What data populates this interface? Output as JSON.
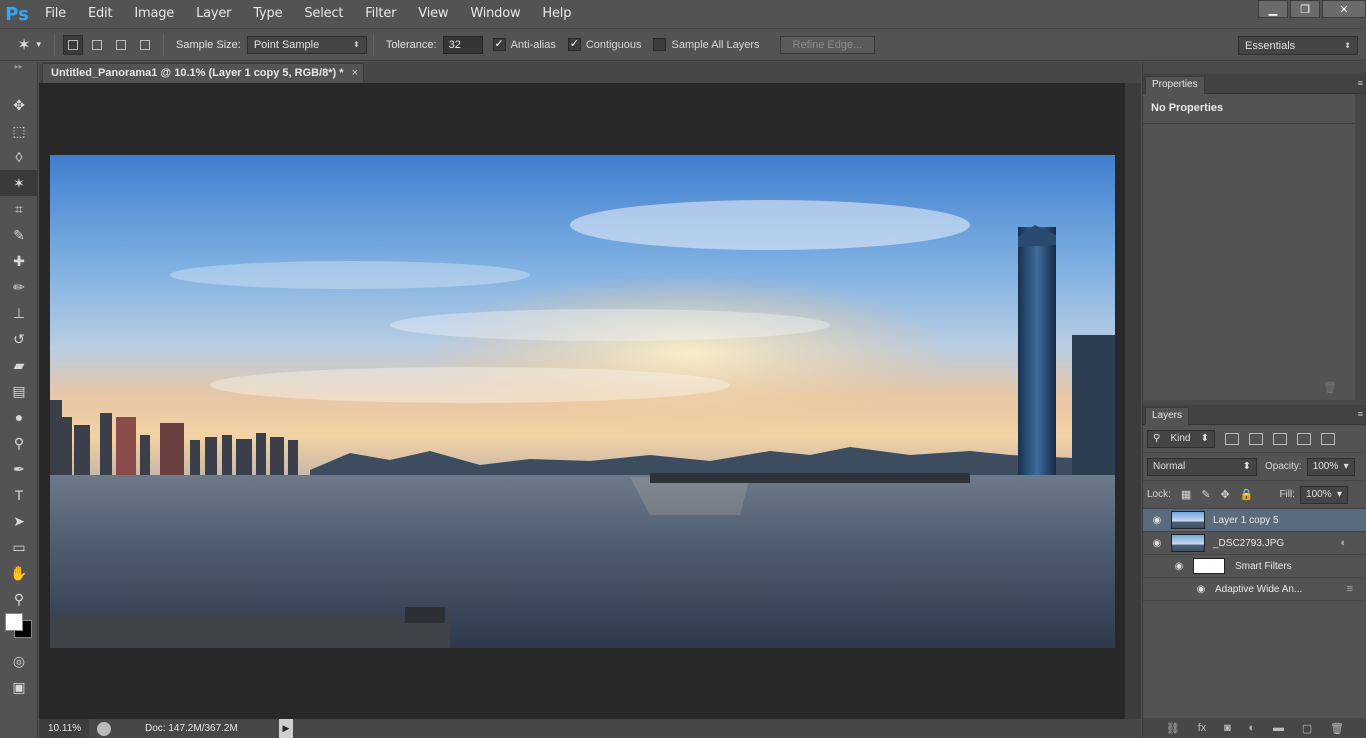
{
  "menubar": {
    "logo": "Ps",
    "items": [
      "File",
      "Edit",
      "Image",
      "Layer",
      "Type",
      "Select",
      "Filter",
      "View",
      "Window",
      "Help"
    ]
  },
  "options": {
    "sample_size_label": "Sample Size:",
    "sample_size_value": "Point Sample",
    "tolerance_label": "Tolerance:",
    "tolerance_value": "32",
    "anti_alias_label": "Anti-alias",
    "contiguous_label": "Contiguous",
    "sample_all_label": "Sample All Layers",
    "refine_edge_label": "Refine Edge...",
    "workspace": "Essentials"
  },
  "document": {
    "tab_title": "Untitled_Panorama1 @ 10.1% (Layer 1 copy 5, RGB/8*) *",
    "close_glyph": "×",
    "zoom": "10.11%",
    "doc_size": "Doc: 147.2M/367.2M"
  },
  "properties": {
    "tab": "Properties",
    "text": "No Properties"
  },
  "layers": {
    "tab": "Layers",
    "kind": "Kind",
    "blend_mode": "Normal",
    "opacity_label": "Opacity:",
    "opacity_value": "100%",
    "lock_label": "Lock:",
    "fill_label": "Fill:",
    "fill_value": "100%",
    "items": [
      {
        "name": "Layer 1 copy 5"
      },
      {
        "name": "_DSC2793.JPG"
      },
      {
        "name": "Smart Filters"
      },
      {
        "name": "Adaptive Wide An..."
      }
    ]
  },
  "icons": {
    "ps_logo": "ps-logo",
    "magic_wand": "magic-wand-icon",
    "eye": "eye-icon"
  },
  "colors": {
    "accent": "#31a8ff",
    "panel_bg": "#535353",
    "canvas_bg": "#282828",
    "selected_layer": "#5a6b7e"
  }
}
